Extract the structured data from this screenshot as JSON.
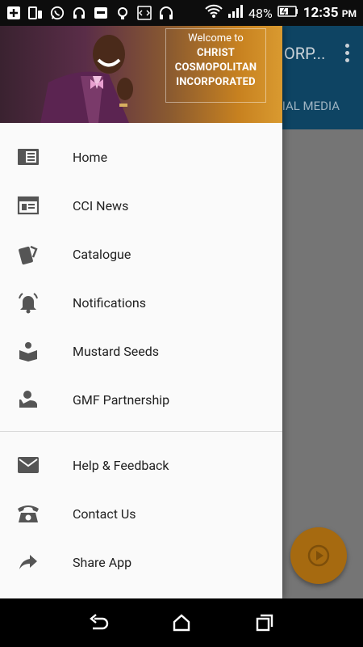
{
  "status_bar": {
    "battery": "48%",
    "time": "12:35",
    "ampm": "PM"
  },
  "app": {
    "title": "ORP...",
    "tab": "CIAL MEDIA"
  },
  "drawer": {
    "welcome": "Welcome to",
    "brand_line1": "CHRIST",
    "brand_line2": "COSMOPOLITAN",
    "brand_line3": "INCORPORATED",
    "items": [
      {
        "label": "Home",
        "icon": "home-icon"
      },
      {
        "label": "CCI News",
        "icon": "news-icon"
      },
      {
        "label": "Catalogue",
        "icon": "catalogue-icon"
      },
      {
        "label": "Notifications",
        "icon": "bell-icon"
      },
      {
        "label": "Mustard Seeds",
        "icon": "book-reader-icon"
      },
      {
        "label": "GMF Partnership",
        "icon": "person-icon"
      }
    ],
    "secondary_items": [
      {
        "label": "Help & Feedback",
        "icon": "mail-icon"
      },
      {
        "label": "Contact Us",
        "icon": "phone-icon"
      },
      {
        "label": "Share App",
        "icon": "share-icon"
      }
    ]
  },
  "colors": {
    "toolbar": "#0e4463",
    "fab": "#a66a10",
    "drawer_bg": "#fafafa",
    "icon": "#555555"
  }
}
